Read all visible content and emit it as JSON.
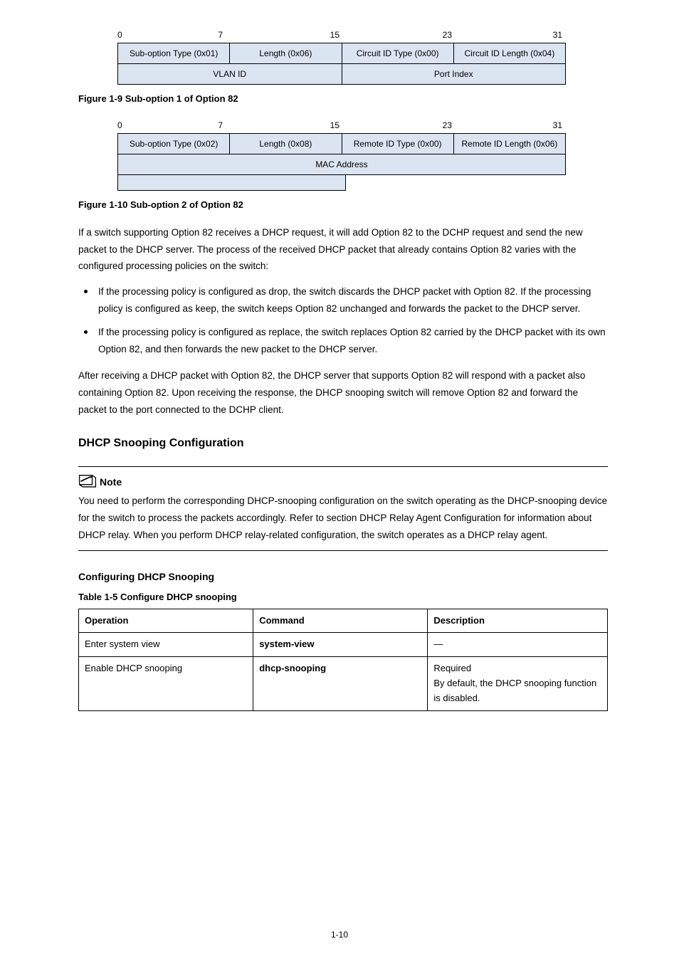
{
  "diagram1": {
    "ticks": {
      "t0": "0",
      "t7": "7",
      "t15": "15",
      "t23": "23",
      "t31": "31"
    },
    "row1": {
      "c1": "Sub-option Type (0x01)",
      "c2": "Length (0x06)",
      "c3": "Circuit ID Type (0x00)",
      "c4": "Circuit ID Length (0x04)"
    },
    "row2": {
      "c1": "VLAN ID",
      "c2": "Port Index"
    },
    "caption": "Figure 1-9 Sub-option 1 of Option 82"
  },
  "diagram2": {
    "ticks": {
      "t0": "0",
      "t7": "7",
      "t15": "15",
      "t23": "23",
      "t31": "31"
    },
    "row1": {
      "c1": "Sub-option Type (0x02)",
      "c2": "Length (0x08)",
      "c3": "Remote ID Type (0x00)",
      "c4": "Remote ID Length (0x06)"
    },
    "row2": {
      "c1": "MAC Address"
    },
    "caption": "Figure 1-10 Sub-option 2 of Option 82"
  },
  "paragraphs": {
    "p1": "If a switch supporting Option 82 receives a DHCP request, it will add Option 82 to the DCHP request and send the new packet to the DHCP server. The process of the received DHCP packet that already contains Option 82 varies with the configured processing policies on the switch:",
    "p2": "After receiving a DHCP packet with Option 82, the DHCP server that supports Option 82 will respond with a packet also containing Option 82. Upon receiving the response, the DHCP snooping switch will remove Option 82 and forward the packet to the port connected to the DCHP client."
  },
  "bullets": {
    "b1": "If the processing policy is configured as drop, the switch discards the DHCP packet with Option 82. If the processing policy is configured as keep, the switch keeps Option 82 unchanged and forwards the packet to the DHCP server.",
    "b2": "If the processing policy is configured as replace, the switch replaces Option 82 carried by the DHCP packet with its own Option 82, and then forwards the new packet to the DHCP server."
  },
  "h3": "DHCP Snooping Configuration",
  "note": {
    "label": "Note",
    "body": "You need to perform the corresponding DHCP-snooping configuration on the switch operating as the DHCP-snooping device for the switch to process the packets accordingly. Refer to section DHCP Relay Agent Configuration for information about DHCP relay. When you perform DHCP relay-related configuration, the switch operates as a DHCP relay agent."
  },
  "config": {
    "h4": "Configuring DHCP Snooping",
    "caption": "Table 1-5 Configure DHCP snooping",
    "headers": {
      "op": "Operation",
      "cmd": "Command",
      "desc": "Description"
    },
    "rows": [
      {
        "op": "Enter system view",
        "cmd": "system-view",
        "desc": "—"
      },
      {
        "op": "Enable DHCP snooping",
        "cmd": "dhcp-snooping",
        "desc": "Required\nBy default, the DHCP snooping function is disabled."
      }
    ]
  },
  "page_num": "1-10"
}
